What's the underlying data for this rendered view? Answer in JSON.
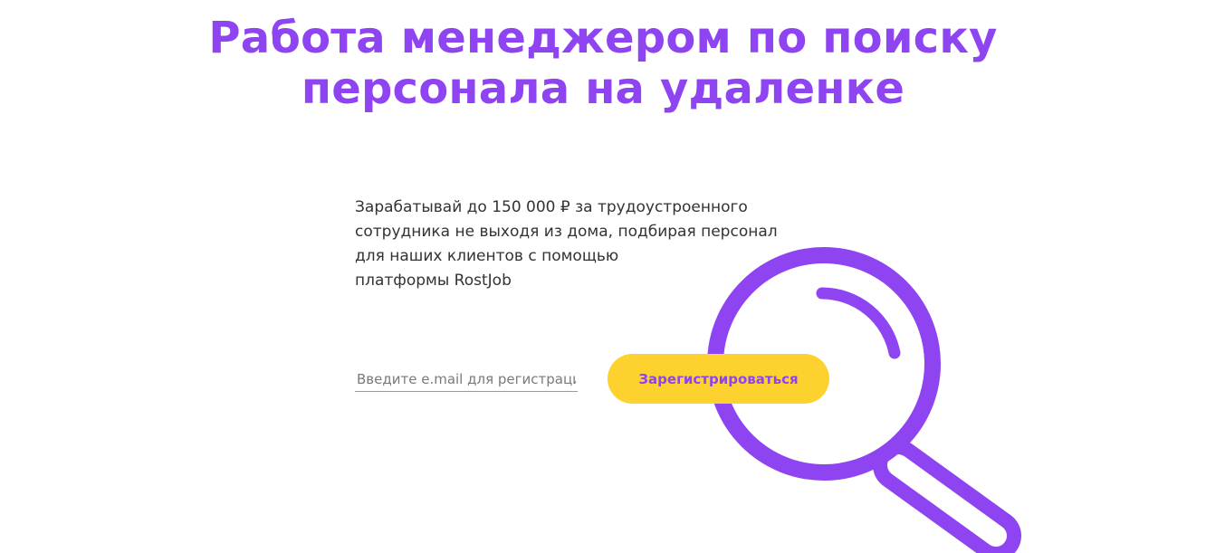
{
  "hero": {
    "title_lines": [
      "Работа менеджером по поиску",
      "персонала на удаленке"
    ]
  },
  "intro": {
    "lines": [
      "Зарабатывай до 150 000 ₽ за трудоустроенного",
      "сотрудника не выходя из дома, подбирая персонал",
      "для наших клиентов с помощью",
      "платформы RostJob"
    ]
  },
  "signup": {
    "email_placeholder": "Введите e.mail для регистрации",
    "email_value": "",
    "button_label": "Зарегистрироваться"
  },
  "decoration": {
    "icon": "magnifier-icon"
  },
  "colors": {
    "accent": "#8e44f0",
    "button_bg": "#fdd22e",
    "text": "#333333",
    "background": "#ffffff"
  }
}
